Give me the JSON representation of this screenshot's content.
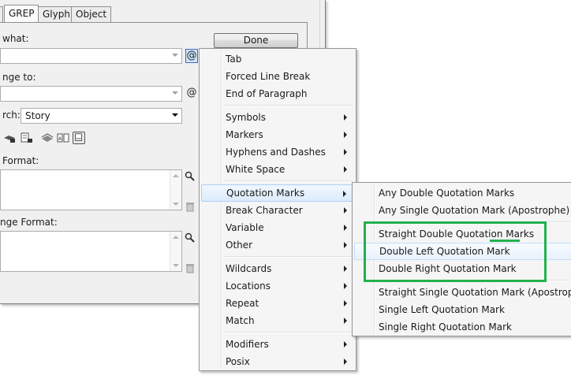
{
  "tabs": [
    {
      "label": "GREP",
      "active": true
    },
    {
      "label": "Glyph",
      "active": false
    },
    {
      "label": "Object",
      "active": false
    }
  ],
  "dialog": {
    "find_label": "what:",
    "change_label": "nge to:",
    "search_label": "rch:",
    "search_value": "Story",
    "find_format_label": "Format:",
    "change_format_label": "nge Format:",
    "done_label": "Done",
    "at_symbol": "@"
  },
  "menu": {
    "groups": [
      [
        {
          "label": "Tab",
          "submenu": false
        },
        {
          "label": "Forced Line Break",
          "submenu": false
        },
        {
          "label": "End of Paragraph",
          "submenu": false
        }
      ],
      [
        {
          "label": "Symbols",
          "submenu": true
        },
        {
          "label": "Markers",
          "submenu": true
        },
        {
          "label": "Hyphens and Dashes",
          "submenu": true
        },
        {
          "label": "White Space",
          "submenu": true
        }
      ],
      [
        {
          "label": "Quotation Marks",
          "submenu": true,
          "highlighted": true
        },
        {
          "label": "Break Character",
          "submenu": true
        },
        {
          "label": "Variable",
          "submenu": true
        },
        {
          "label": "Other",
          "submenu": true
        }
      ],
      [
        {
          "label": "Wildcards",
          "submenu": true
        },
        {
          "label": "Locations",
          "submenu": true
        },
        {
          "label": "Repeat",
          "submenu": true
        },
        {
          "label": "Match",
          "submenu": true
        }
      ],
      [
        {
          "label": "Modifiers",
          "submenu": true
        },
        {
          "label": "Posix",
          "submenu": true
        }
      ]
    ]
  },
  "submenu": {
    "groups": [
      [
        {
          "label": "Any Double Quotation Marks"
        },
        {
          "label": "Any Single Quotation Mark (Apostrophe)"
        }
      ],
      [
        {
          "label": "Straight Double Quotation Marks"
        },
        {
          "label": "Double Left Quotation Mark",
          "hover": true
        },
        {
          "label": "Double Right Quotation Mark"
        }
      ],
      [
        {
          "label": "Straight Single Quotation Mark (Apostrophe)"
        },
        {
          "label": "Single Left Quotation Mark"
        },
        {
          "label": "Single Right Quotation Mark"
        }
      ]
    ]
  },
  "annotation_color": "#22b14c"
}
